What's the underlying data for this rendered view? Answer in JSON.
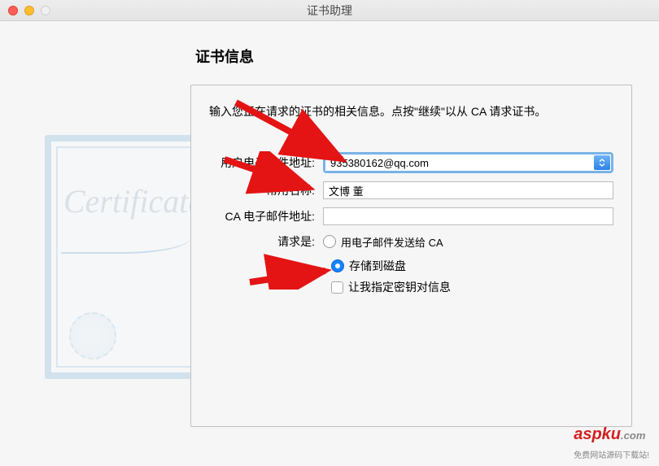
{
  "window": {
    "title": "证书助理"
  },
  "section": {
    "heading": "证书信息",
    "instruction": "输入您正在请求的证书的相关信息。点按\"继续\"以从 CA 请求证书。"
  },
  "form": {
    "email_label": "用户电子邮件地址:",
    "email_value": "935380162@qq.com",
    "name_label": "常用名称:",
    "name_value": "文博 董",
    "ca_email_label": "CA 电子邮件地址:",
    "ca_email_value": "",
    "request_label": "请求是:",
    "radio_email": "用电子邮件发送给 CA",
    "radio_disk": "存储到磁盘",
    "checkbox_keypair": "让我指定密钥对信息"
  },
  "watermark": {
    "brand": "aspku",
    "suffix": ".com",
    "tag": "免费网站源码下载站!"
  }
}
